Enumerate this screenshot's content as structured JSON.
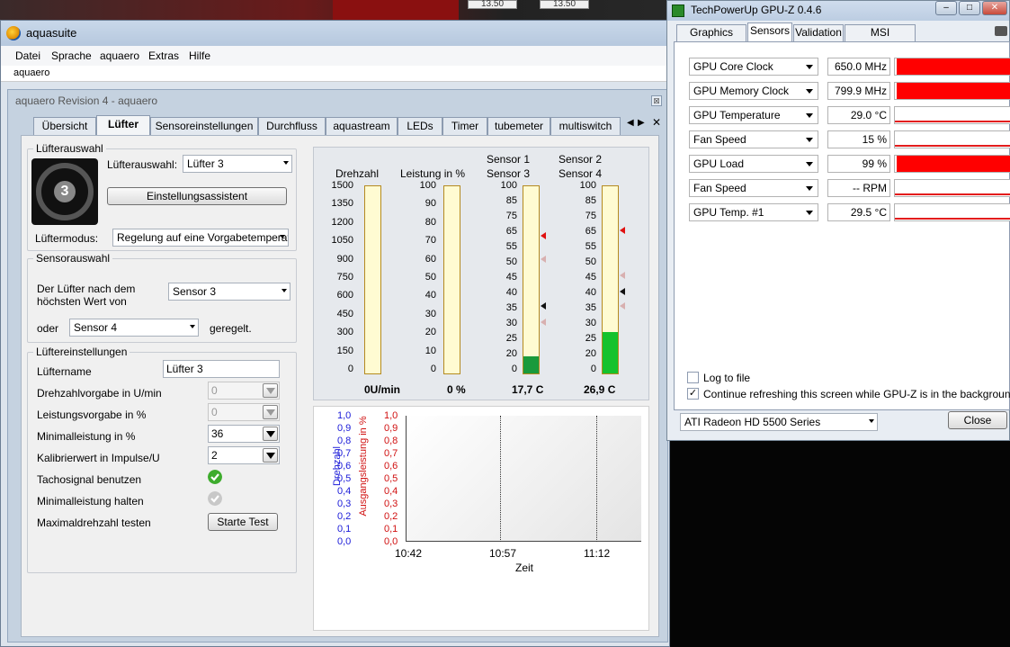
{
  "background": {
    "field1": "13.50",
    "field2": "13.50"
  },
  "aquasuite": {
    "title": "aquasuite",
    "menu": [
      "Datei",
      "Sprache",
      "aquaero",
      "Extras",
      "Hilfe"
    ],
    "crumb": "aquaero",
    "inner_title": "aquaero Revision 4 -  aquaero",
    "close_glyph": "⊠",
    "tabs": [
      "Übersicht",
      "Lüfter",
      "Sensoreinstellungen",
      "Durchfluss",
      "aquastream",
      "LEDs",
      "Timer",
      "tubemeter",
      "multiswitch"
    ],
    "active_tab": "Lüfter",
    "tab_nav": {
      "prev": "◀",
      "next": "▶",
      "close": "✕"
    },
    "fan_select": {
      "group": "Lüfterauswahl",
      "label": "Lüfterauswahl:",
      "value": "Lüfter 3",
      "badge": "3",
      "assistant_button": "Einstellungsassistent",
      "mode_label": "Lüftermodus:",
      "mode_value": "Regelung auf eine Vorgabetemperatu"
    },
    "sensor_select": {
      "group": "Sensorauswahl",
      "label_line1": "Der Lüfter nach dem",
      "label_line2": "höchsten Wert von",
      "value1": "Sensor 3",
      "or_label": "oder",
      "value2": "Sensor 4",
      "suffix": "geregelt."
    },
    "fan_settings": {
      "group": "Lüftereinstellungen",
      "rows": [
        {
          "label": "Lüftername",
          "value": "Lüfter 3"
        },
        {
          "label": "Drehzahlvorgabe in U/min",
          "value": "0"
        },
        {
          "label": "Leistungsvorgabe in %",
          "value": "0"
        },
        {
          "label": "Minimalleistung in %",
          "value": "36"
        },
        {
          "label": "Kalibrierwert in Impulse/U",
          "value": "2"
        },
        {
          "label": "Tachosignal benutzen"
        },
        {
          "label": "Minimalleistung halten"
        },
        {
          "label": "Maximaldrehzahl testen"
        }
      ],
      "test_button": "Starte Test"
    },
    "meters": {
      "rpm_title": "Drehzahl",
      "power_title": "Leistung in %",
      "s1_title_a": "Sensor 1",
      "s1_title_b": "Sensor 3",
      "s2_title_a": "Sensor 2",
      "s2_title_b": "Sensor 4",
      "rpm_ticks": [
        "1500",
        "1350",
        "1200",
        "1050",
        "900",
        "750",
        "600",
        "450",
        "300",
        "150",
        "0"
      ],
      "pct_ticks": [
        "100",
        "90",
        "80",
        "70",
        "60",
        "50",
        "40",
        "30",
        "20",
        "10",
        "0"
      ],
      "temp_ticks": [
        "100",
        "85",
        "75",
        "65",
        "55",
        "50",
        "45",
        "40",
        "35",
        "30",
        "25",
        "20",
        "0"
      ],
      "rpm_value": "0U/min",
      "power_value": "0 %",
      "s3_value": "17,7 C",
      "s4_value": "26,9 C",
      "s3_fill_fraction": 0.09,
      "s4_fill_fraction": 0.22
    },
    "graph": {
      "ylabel_left": "Drehzahl",
      "ylabel_right": "Ausgangsleistung in %",
      "yticks": [
        "1,0",
        "0,9",
        "0,8",
        "0,7",
        "0,6",
        "0,5",
        "0,4",
        "0,3",
        "0,2",
        "0,1",
        "0,0"
      ],
      "xticks": [
        "10:42",
        "10:57",
        "11:12"
      ],
      "xlabel": "Zeit"
    }
  },
  "gpuz": {
    "title": "TechPowerUp GPU-Z 0.4.6",
    "tabs": [
      "Graphics Card",
      "Sensors",
      "Validation",
      "MSI Giveaway"
    ],
    "active_tab": "Sensors",
    "sensors": [
      {
        "name": "GPU Core Clock",
        "value": "650.0 MHz",
        "fill": 1.0
      },
      {
        "name": "GPU Memory Clock",
        "value": "799.9 MHz",
        "fill": 1.0
      },
      {
        "name": "GPU Temperature",
        "value": "29.0 °C",
        "fill": 0
      },
      {
        "name": "Fan Speed",
        "value": "15 %",
        "fill": 0
      },
      {
        "name": "GPU Load",
        "value": "99 %",
        "fill": 1.0
      },
      {
        "name": "Fan Speed",
        "value": "-- RPM",
        "fill": 0
      },
      {
        "name": "GPU Temp. #1",
        "value": "29.5 °C",
        "fill": 0
      }
    ],
    "log_label": "Log to file",
    "continue_label": "Continue refreshing this screen while GPU-Z is in the background",
    "gpu_select": "ATI Radeon HD 5500 Series",
    "close_button": "Close"
  }
}
